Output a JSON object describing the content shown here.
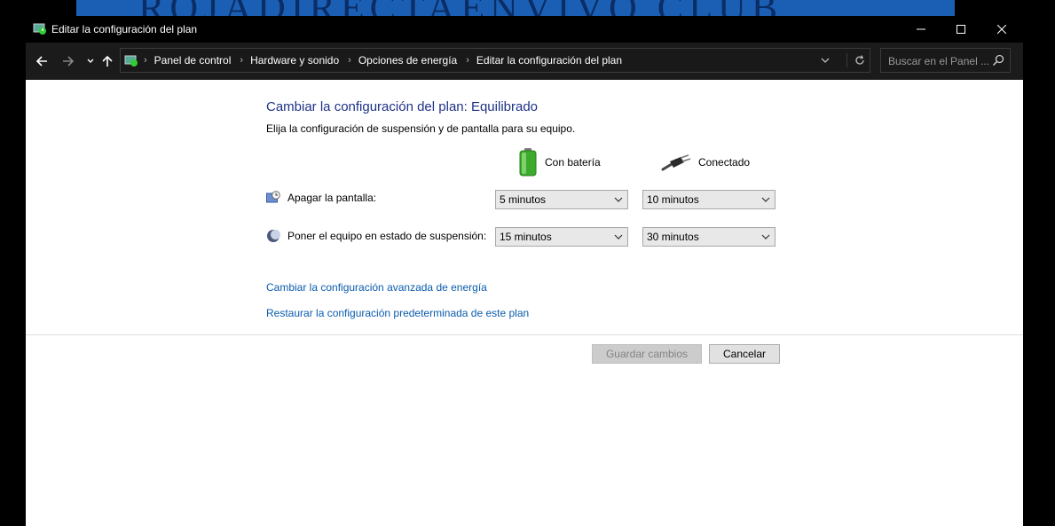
{
  "background": {
    "banner_text": "ROJADIRECTAENVIVO.CLUB"
  },
  "window": {
    "title": "Editar la configuración del plan"
  },
  "addressbar": {
    "crumbs": [
      "Panel de control",
      "Hardware y sonido",
      "Opciones de energía",
      "Editar la configuración del plan"
    ],
    "search_placeholder": "Buscar en el Panel ..."
  },
  "main": {
    "title": "Cambiar la configuración del plan: Equilibrado",
    "subtitle": "Elija la configuración de suspensión y de pantalla para su equipo.",
    "columns": {
      "battery": "Con batería",
      "plugged": "Conectado"
    },
    "rows": [
      {
        "label": "Apagar la pantalla:",
        "battery": "5 minutos",
        "plugged": "10 minutos",
        "icon": "display-timer-icon"
      },
      {
        "label": "Poner el equipo en estado de suspensión:",
        "battery": "15 minutos",
        "plugged": "30 minutos",
        "icon": "sleep-moon-icon"
      }
    ],
    "links": {
      "advanced": "Cambiar la configuración avanzada de energía",
      "restore": "Restaurar la configuración predeterminada de este plan"
    },
    "buttons": {
      "save": "Guardar cambios",
      "cancel": "Cancelar"
    }
  },
  "colors": {
    "title_blue": "#1e3287",
    "link_blue": "#0b5cad",
    "titlebar": "#000000",
    "addressbar": "#1b1b1b"
  }
}
